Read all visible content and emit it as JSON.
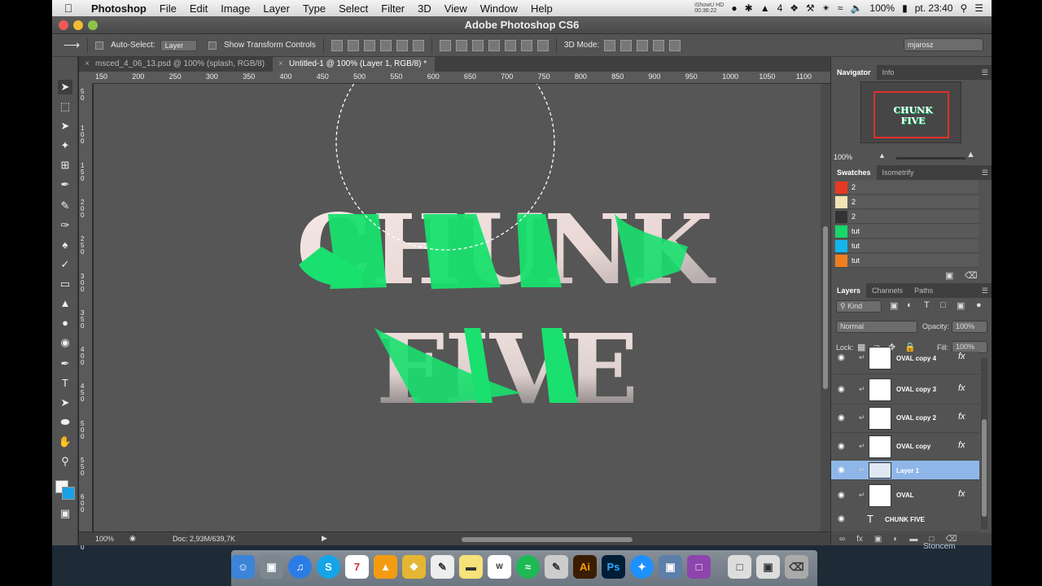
{
  "menubar": {
    "app": "Photoshop",
    "items": [
      "File",
      "Edit",
      "Image",
      "Layer",
      "Type",
      "Select",
      "Filter",
      "3D",
      "View",
      "Window",
      "Help"
    ],
    "status_small_1": "iShowU HD",
    "status_small_2": "00:36:22",
    "badge_count": "4",
    "battery": "100%",
    "clock": "pt. 23:40"
  },
  "window": {
    "title": "Adobe Photoshop CS6"
  },
  "options": {
    "auto_select": "Auto-Select:",
    "auto_select_value": "Layer",
    "show_transform": "Show Transform Controls",
    "mode_3d": "3D Mode:",
    "workspace": "mjarosz"
  },
  "tabs": [
    {
      "label": "msced_4_06_13.psd @ 100% (splash, RGB/8)"
    },
    {
      "label": "Untitled-1 @ 100% (Layer 1, RGB/8) *"
    }
  ],
  "ruler_top": [
    "150",
    "200",
    "250",
    "300",
    "350",
    "400",
    "450",
    "500",
    "550",
    "600",
    "650",
    "700",
    "750",
    "800",
    "850",
    "900",
    "950",
    "1000",
    "1050",
    "1100"
  ],
  "ruler_left": [
    "50",
    "100",
    "150",
    "200",
    "250",
    "300",
    "350",
    "400",
    "450",
    "500",
    "550",
    "600",
    "650"
  ],
  "canvas_text": {
    "line1": "CHUNK",
    "line2": "FIVE"
  },
  "status": {
    "zoom": "100%",
    "doc": "Doc: 2,93M/639,7K"
  },
  "panels": {
    "navigator_tabs": [
      "Navigator",
      "Info"
    ],
    "navigator_zoom": "100%",
    "nav_preview_line1": "CHUNK",
    "nav_preview_line2": "FIVE",
    "swatches_tabs": [
      "Swatches",
      "Isometrify"
    ],
    "swatches": [
      {
        "name": "2",
        "color": "#e8381f"
      },
      {
        "name": "2",
        "color": "#f2e2b4"
      },
      {
        "name": "2",
        "color": "#333333"
      },
      {
        "name": "tut",
        "color": "#19d66b"
      },
      {
        "name": "tut",
        "color": "#13b5ef"
      },
      {
        "name": "tut",
        "color": "#f07e20"
      }
    ],
    "layers_tabs": [
      "Layers",
      "Channels",
      "Paths"
    ],
    "kind": "Kind",
    "blend": "Normal",
    "opacity_label": "Opacity:",
    "opacity": "100%",
    "lock_label": "Lock:",
    "fill_label": "Fill:",
    "fill": "100%",
    "layers": [
      {
        "name": "OVAL copy 4",
        "fx": "fx"
      },
      {
        "name": "OVAL copy 3",
        "fx": "fx"
      },
      {
        "name": "OVAL copy 2",
        "fx": "fx"
      },
      {
        "name": "OVAL copy",
        "fx": "fx"
      },
      {
        "name": "Layer 1",
        "fx": ""
      },
      {
        "name": "OVAL",
        "fx": "fx"
      },
      {
        "name": "CHUNK FIVE",
        "fx": ""
      }
    ]
  },
  "colors": {
    "green": "#19e06e",
    "accent": "#e0302c"
  },
  "watermark": "Stoncem"
}
